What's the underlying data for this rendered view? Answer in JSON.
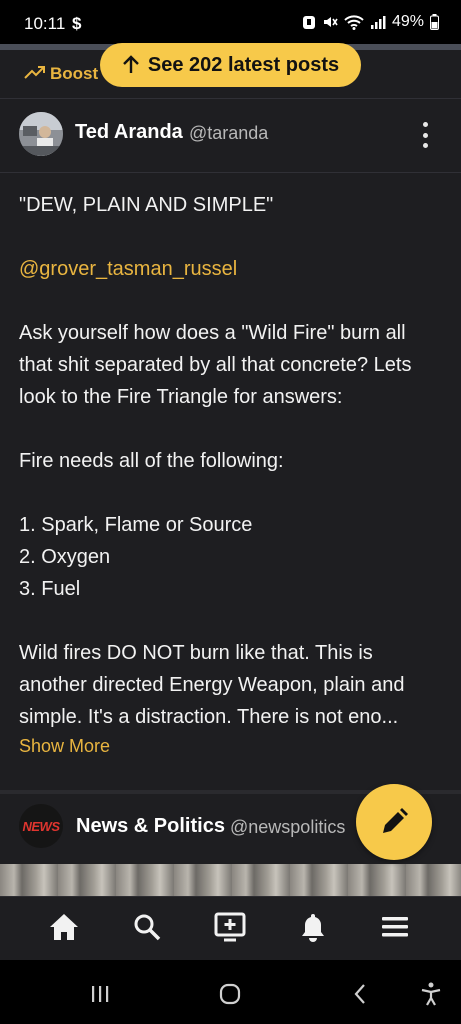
{
  "status_bar": {
    "time": "10:11",
    "notification_symbol": "$",
    "battery": "49%",
    "icons": [
      "alarm-icon",
      "mute-icon",
      "wifi-icon",
      "signal-icon",
      "battery-icon"
    ]
  },
  "boost_row": {
    "label": "Boosted",
    "visible_label": "Boost",
    "icon": "trending-up-icon"
  },
  "latest_posts_pill": {
    "label": "See 202 latest posts",
    "icon": "arrow-up-icon"
  },
  "post": {
    "author_name": "Ted Aranda",
    "author_handle": "@taranda",
    "paragraphs": [
      "\"DEW, PLAIN AND SIMPLE\"",
      "@grover_tasman_russel",
      "Ask yourself how does a \"Wild Fire\" burn all that shit separated by all that concrete? Lets look to the Fire Triangle for answers:",
      "Fire needs all of the following:"
    ],
    "list_items": [
      "1. Spark, Flame or Source",
      "2. Oxygen",
      "3. Fuel"
    ],
    "closing": "Wild fires DO NOT burn like that. This is another directed Energy Weapon, plain and simple. It's a distraction. There is not eno...",
    "show_more": "Show More"
  },
  "next_post": {
    "avatar_text": "NEWS",
    "author_name": "News & Politics",
    "author_handle": "@newspolitics"
  },
  "fab": {
    "icon": "pencil-icon"
  },
  "bottom_nav": [
    "home-icon",
    "search-icon",
    "new-post-icon",
    "bell-icon",
    "menu-icon"
  ],
  "system_nav": [
    "recents-icon",
    "home-circle-icon",
    "back-icon",
    "accessibility-icon"
  ],
  "colors": {
    "accent": "#f7c94a",
    "link": "#e9b540",
    "background": "#1e1e21"
  }
}
